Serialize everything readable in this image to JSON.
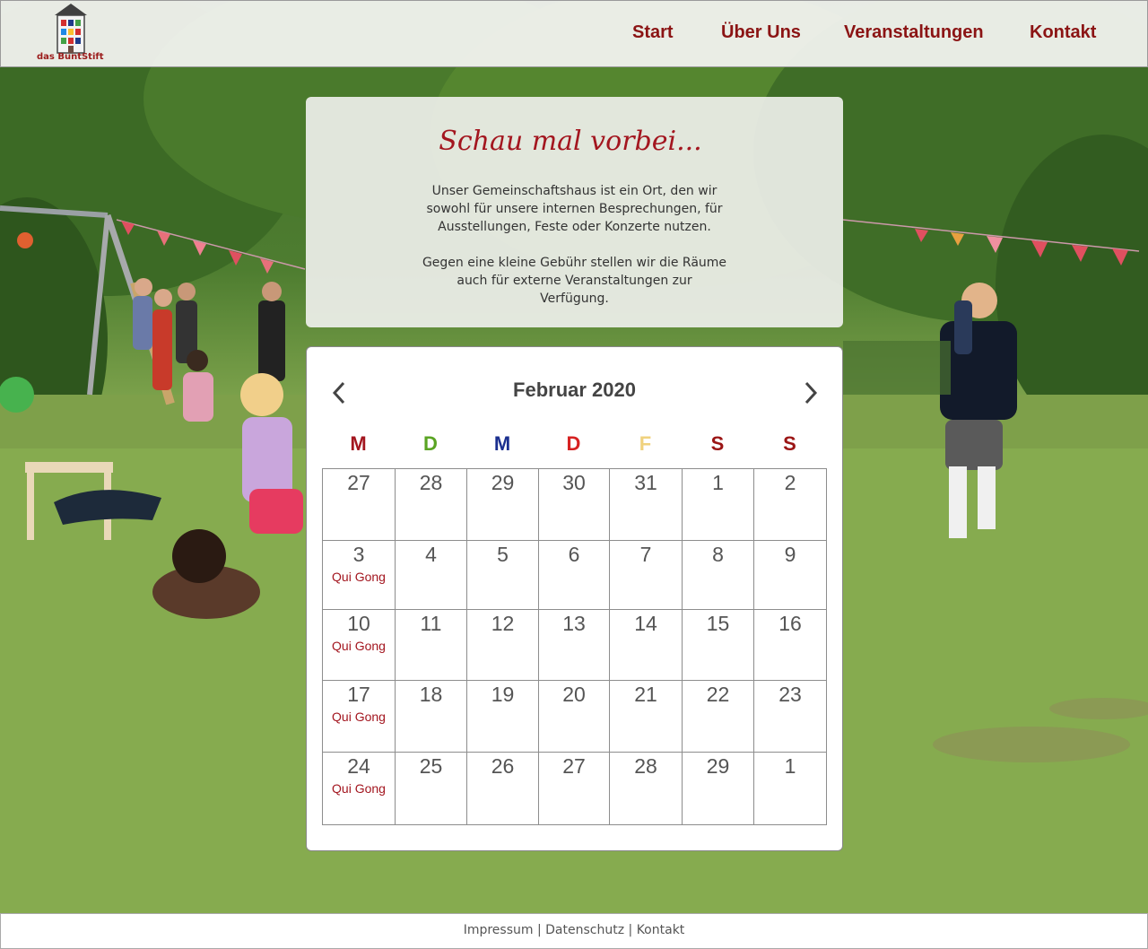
{
  "header": {
    "logo_text": "das BuntStift",
    "nav": [
      "Start",
      "Über Uns",
      "Veranstaltungen",
      "Kontakt"
    ]
  },
  "intro": {
    "title": "Schau mal vorbei...",
    "paragraph1": "Unser Gemeinschaftshaus ist ein Ort, den wir sowohl für unsere internen Besprechungen, für Ausstellungen, Feste oder Konzerte nutzen.",
    "paragraph2": "Gegen eine kleine Gebühr stellen wir die Räume auch für externe Veranstaltungen zur Verfügung."
  },
  "calendar": {
    "month_label": "Februar 2020",
    "weekdays": [
      {
        "label": "M",
        "color": "#a3161f"
      },
      {
        "label": "D",
        "color": "#5aa423"
      },
      {
        "label": "M",
        "color": "#1b2f8f"
      },
      {
        "label": "D",
        "color": "#d62222"
      },
      {
        "label": "F",
        "color": "#f0d27e"
      },
      {
        "label": "S",
        "color": "#9b1515"
      },
      {
        "label": "S",
        "color": "#9b1515"
      }
    ],
    "weeks": [
      [
        {
          "day": "27",
          "event": ""
        },
        {
          "day": "28",
          "event": ""
        },
        {
          "day": "29",
          "event": ""
        },
        {
          "day": "30",
          "event": ""
        },
        {
          "day": "31",
          "event": ""
        },
        {
          "day": "1",
          "event": ""
        },
        {
          "day": "2",
          "event": ""
        }
      ],
      [
        {
          "day": "3",
          "event": "Qui Gong"
        },
        {
          "day": "4",
          "event": ""
        },
        {
          "day": "5",
          "event": ""
        },
        {
          "day": "6",
          "event": ""
        },
        {
          "day": "7",
          "event": ""
        },
        {
          "day": "8",
          "event": ""
        },
        {
          "day": "9",
          "event": ""
        }
      ],
      [
        {
          "day": "10",
          "event": "Qui Gong"
        },
        {
          "day": "11",
          "event": ""
        },
        {
          "day": "12",
          "event": ""
        },
        {
          "day": "13",
          "event": ""
        },
        {
          "day": "14",
          "event": ""
        },
        {
          "day": "15",
          "event": ""
        },
        {
          "day": "16",
          "event": ""
        }
      ],
      [
        {
          "day": "17",
          "event": "Qui Gong"
        },
        {
          "day": "18",
          "event": ""
        },
        {
          "day": "19",
          "event": ""
        },
        {
          "day": "20",
          "event": ""
        },
        {
          "day": "21",
          "event": ""
        },
        {
          "day": "22",
          "event": ""
        },
        {
          "day": "23",
          "event": ""
        }
      ],
      [
        {
          "day": "24",
          "event": "Qui Gong"
        },
        {
          "day": "25",
          "event": ""
        },
        {
          "day": "26",
          "event": ""
        },
        {
          "day": "27",
          "event": ""
        },
        {
          "day": "28",
          "event": ""
        },
        {
          "day": "29",
          "event": ""
        },
        {
          "day": "1",
          "event": ""
        }
      ]
    ]
  },
  "footer": {
    "links": [
      "Impressum",
      "Datenschutz",
      "Kontakt"
    ],
    "separator": "|"
  },
  "colors": {
    "accent": "#8b1414",
    "event": "#a3161f"
  }
}
